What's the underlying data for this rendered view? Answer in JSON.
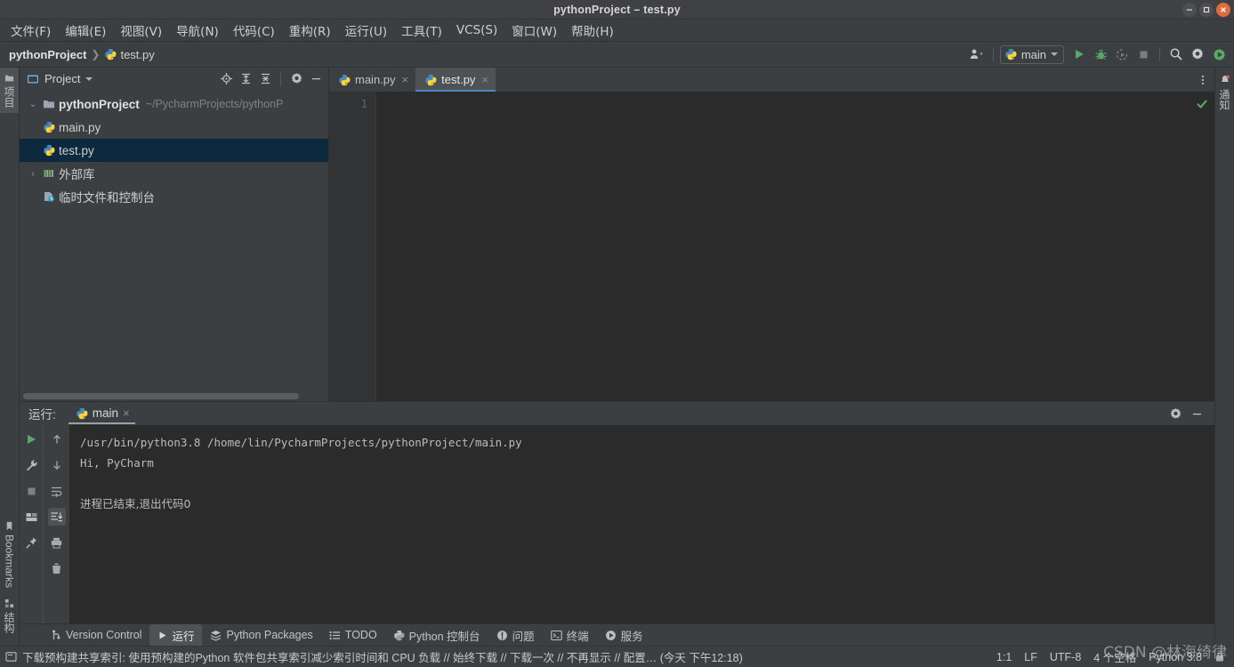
{
  "window": {
    "title": "pythonProject – test.py",
    "controls": {
      "minimize": "minimize-icon",
      "maximize": "maximize-icon",
      "close": "close-icon"
    }
  },
  "menubar": {
    "items": [
      {
        "label": "文件(F)"
      },
      {
        "label": "编辑(E)"
      },
      {
        "label": "视图(V)"
      },
      {
        "label": "导航(N)"
      },
      {
        "label": "代码(C)"
      },
      {
        "label": "重构(R)"
      },
      {
        "label": "运行(U)"
      },
      {
        "label": "工具(T)"
      },
      {
        "label": "VCS(S)"
      },
      {
        "label": "窗口(W)"
      },
      {
        "label": "帮助(H)"
      }
    ]
  },
  "navbar": {
    "breadcrumb": {
      "project": "pythonProject",
      "separator": "❯",
      "file": "test.py"
    },
    "toolbar": {
      "account_icon": "user-account-icon",
      "run_config": {
        "label": "main",
        "icon": "python-icon"
      },
      "run_button": "run-icon",
      "debug_button": "debug-icon",
      "coverage_button": "run-with-coverage-icon",
      "stop_button": "stop-icon",
      "search_button": "search-icon",
      "settings_button": "gear-icon",
      "updates_button": "ide-update-icon"
    }
  },
  "left_strip": {
    "tabs": [
      {
        "label": "项目",
        "icon": "project-folder-icon",
        "active": true
      },
      {
        "label": "Bookmarks",
        "icon": "bookmark-icon",
        "active": false
      },
      {
        "label": "结构",
        "icon": "structure-icon",
        "active": false
      }
    ]
  },
  "right_strip": {
    "tabs": [
      {
        "label": "通知",
        "icon": "notifications-bell-icon"
      }
    ]
  },
  "project_panel": {
    "title": "Project",
    "tools": {
      "locate": "locate-file-icon",
      "expand_all": "expand-all-icon",
      "collapse_all": "collapse-all-icon",
      "settings": "gear-icon",
      "hide": "hide-icon"
    },
    "tree": [
      {
        "label": "pythonProject",
        "path": "~/PycharmProjects/pythonP",
        "icon": "folder-icon",
        "arrow": "expanded",
        "indent": 0,
        "selected": false,
        "bold": true
      },
      {
        "label": "main.py",
        "path": "",
        "icon": "python-file-icon",
        "arrow": "none",
        "indent": 1,
        "selected": false,
        "bold": false
      },
      {
        "label": "test.py",
        "path": "",
        "icon": "python-file-icon",
        "arrow": "none",
        "indent": 1,
        "selected": true,
        "bold": false
      },
      {
        "label": "外部库",
        "path": "",
        "icon": "external-libraries-icon",
        "arrow": "collapsed",
        "indent": 0,
        "selected": false,
        "bold": false
      },
      {
        "label": "临时文件和控制台",
        "path": "",
        "icon": "scratches-icon",
        "arrow": "none",
        "indent": 0,
        "selected": false,
        "bold": false
      }
    ]
  },
  "editor": {
    "tabs": [
      {
        "label": "main.py",
        "icon": "python-file-icon",
        "active": false,
        "close": "×"
      },
      {
        "label": "test.py",
        "icon": "python-file-icon",
        "active": true,
        "close": "×"
      }
    ],
    "options_icon": "more-options-icon",
    "line_numbers": [
      "1"
    ],
    "content": "",
    "inspection_status": "inspections-ok-checkmark"
  },
  "run_window": {
    "label": "运行:",
    "tab": {
      "label": "main",
      "icon": "python-icon",
      "close": "×"
    },
    "header_tools": {
      "settings": "gear-icon",
      "hide": "hide-icon"
    },
    "left_tools": [
      {
        "icon": "rerun-icon",
        "name": "rerun-button"
      },
      {
        "icon": "wrench-icon",
        "name": "edit-configuration-button"
      },
      {
        "icon": "stop-icon",
        "name": "stop-button"
      },
      {
        "icon": "layout-icon",
        "name": "layout-settings-button"
      },
      {
        "icon": "pin-icon",
        "name": "pin-tab-button"
      }
    ],
    "console_tools": [
      {
        "icon": "arrow-up-icon",
        "name": "previous-occurrence-button",
        "active": false
      },
      {
        "icon": "arrow-down-icon",
        "name": "next-occurrence-button",
        "active": false
      },
      {
        "icon": "soft-wrap-icon",
        "name": "soft-wrap-button",
        "active": false
      },
      {
        "icon": "scroll-to-end-icon",
        "name": "scroll-to-end-button",
        "active": true
      },
      {
        "icon": "print-icon",
        "name": "print-button",
        "active": false
      },
      {
        "icon": "trash-icon",
        "name": "clear-all-button",
        "active": false
      }
    ],
    "console_output": [
      {
        "text": "/usr/bin/python3.8 /home/lin/PycharmProjects/pythonProject/main.py",
        "zh": false
      },
      {
        "text": "Hi, PyCharm",
        "zh": false
      },
      {
        "text": "",
        "zh": false
      },
      {
        "text": "进程已结束,退出代码0",
        "zh": true
      }
    ]
  },
  "bottom_bar": {
    "items": [
      {
        "label": "Version Control",
        "icon": "branch-icon",
        "active": false
      },
      {
        "label": "运行",
        "icon": "run-triangle-icon",
        "active": true
      },
      {
        "label": "Python Packages",
        "icon": "packages-icon",
        "active": false
      },
      {
        "label": "TODO",
        "icon": "todo-list-icon",
        "active": false
      },
      {
        "label": "Python 控制台",
        "icon": "python-console-icon",
        "active": false
      },
      {
        "label": "问题",
        "icon": "problems-icon",
        "active": false
      },
      {
        "label": "终端",
        "icon": "terminal-icon",
        "active": false
      },
      {
        "label": "服务",
        "icon": "services-icon",
        "active": false
      }
    ]
  },
  "status_bar": {
    "notification_icon": "event-log-icon",
    "message": "下载预构建共享索引: 使用预构建的Python 软件包共享索引减少索引时间和 CPU 负载 // 始终下载 // 下载一次 // 不再显示 // 配置… (今天 下午12:18)",
    "caret_position": "1:1",
    "line_separator": "LF",
    "encoding": "UTF-8",
    "indent": "4 个空格",
    "interpreter": "Python 3.8",
    "lock_icon": "read-only-lock-icon"
  },
  "watermark": {
    "text": "CSDN @林海绮律"
  }
}
